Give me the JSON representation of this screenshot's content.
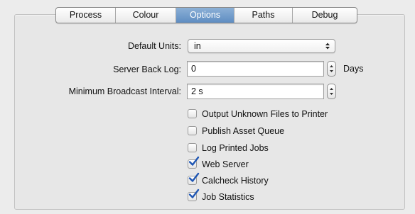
{
  "tabs": [
    {
      "label": "Process",
      "selected": false
    },
    {
      "label": "Colour",
      "selected": false
    },
    {
      "label": "Options",
      "selected": true
    },
    {
      "label": "Paths",
      "selected": false
    },
    {
      "label": "Debug",
      "selected": false
    }
  ],
  "form": {
    "default_units": {
      "label": "Default Units:",
      "value": "in"
    },
    "server_back_log": {
      "label": "Server Back Log:",
      "value": "0",
      "unit": "Days"
    },
    "min_broadcast_interval": {
      "label": "Minimum Broadcast Interval:",
      "value": "2 s"
    }
  },
  "checkboxes": [
    {
      "label": "Output Unknown Files to Printer",
      "checked": false
    },
    {
      "label": "Publish Asset Queue",
      "checked": false
    },
    {
      "label": "Log Printed Jobs",
      "checked": false
    },
    {
      "label": "Web Server",
      "checked": true
    },
    {
      "label": "Calcheck History",
      "checked": true
    },
    {
      "label": "Job Statistics",
      "checked": true
    }
  ],
  "colors": {
    "selected_tab": "#6f9bcb",
    "checkmark": "#1f56b3",
    "panel_background": "#e7e7e7"
  }
}
